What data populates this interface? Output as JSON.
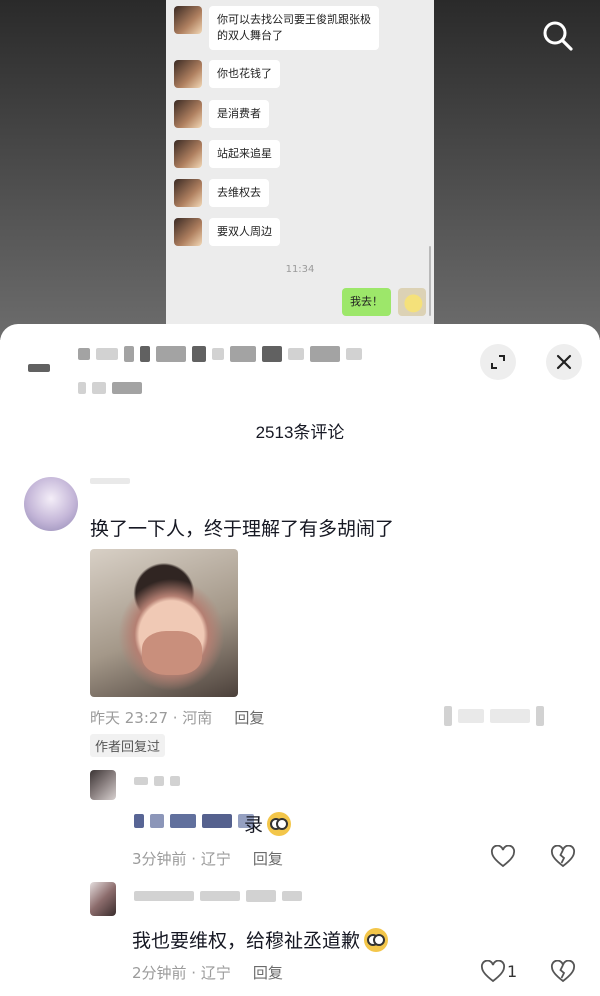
{
  "chat_screenshot": {
    "messages": [
      {
        "text": "你可以去找公司要王俊凯跟张极\n的双人舞台了"
      },
      {
        "text": "你也花钱了"
      },
      {
        "text": "是消费者"
      },
      {
        "text": "站起来追星"
      },
      {
        "text": "去维权去"
      },
      {
        "text": "要双人周边"
      }
    ],
    "time": "11:34",
    "self_message": "我去！"
  },
  "header": {
    "search_icon": "search-icon"
  },
  "sheet": {
    "expand_icon": "expand-icon",
    "close_icon": "close-icon",
    "comment_count": "2513条评论"
  },
  "comments": {
    "main": {
      "text": "换了一下人，终于理解了有多胡闹了",
      "meta": "昨天 23:27 · 河南",
      "reply_label": "回复",
      "author_tag": "作者回复过"
    },
    "replies": [
      {
        "text_tail": "录",
        "meta": "3分钟前 · 辽宁",
        "reply_label": "回复",
        "like_count": ""
      },
      {
        "text": "我也要维权，给穆祉丞道歉",
        "meta": "2分钟前 · 辽宁",
        "reply_label": "回复",
        "like_count": "1"
      }
    ]
  }
}
